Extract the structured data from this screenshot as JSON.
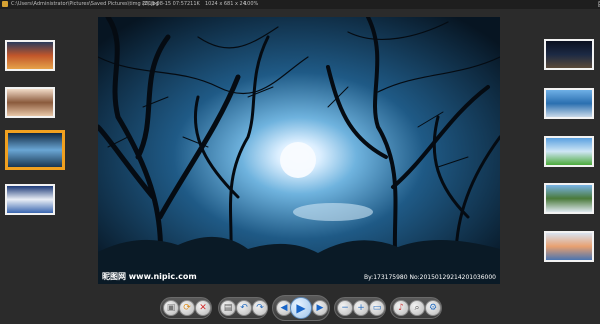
{
  "titlebar": {
    "path": "C:\\Users\\Administrator\\Pictures\\Saved Pictures\\timg (2).jpg",
    "date": "2019-08-15 07:57",
    "size": "211K",
    "dimensions": "1024 x 681 x 24",
    "zoom": "100%",
    "controls": {
      "minimize": "–",
      "maximize": "□",
      "close": "✕"
    }
  },
  "left_thumbnails": [
    {
      "name": "thumb-sunset-lake",
      "colors": [
        "#2a3b5c",
        "#c2562a",
        "#e6a24a"
      ]
    },
    {
      "name": "thumb-portrait",
      "colors": [
        "#f2dcc8",
        "#8a5a3c",
        "#e8c7a8"
      ]
    },
    {
      "name": "thumb-moon-forest",
      "colors": [
        "#0f2740",
        "#6aa6d4",
        "#1a3650"
      ],
      "selected": true
    },
    {
      "name": "thumb-night-house",
      "colors": [
        "#1d3a78",
        "#e9eef6",
        "#3a66b0"
      ]
    }
  ],
  "right_thumbnails": [
    {
      "name": "thumb-star-trails",
      "colors": [
        "#0b1020",
        "#1c2a44",
        "#5a4a3a"
      ]
    },
    {
      "name": "thumb-coast",
      "colors": [
        "#6fb0e6",
        "#2a6fb0",
        "#c9d9e8"
      ]
    },
    {
      "name": "thumb-green-field",
      "colors": [
        "#5aa0e0",
        "#cfe6f5",
        "#4caa3c"
      ]
    },
    {
      "name": "thumb-alpine-village",
      "colors": [
        "#7ab4e6",
        "#4a7a3a",
        "#dfe8ef"
      ]
    },
    {
      "name": "thumb-sunset-sea",
      "colors": [
        "#d8e2ef",
        "#e8a070",
        "#4a74b0"
      ]
    }
  ],
  "main_image": {
    "watermark_left": "昵图网 www.nipic.com",
    "watermark_right": "By:173175980 No:20150129214201036000"
  },
  "toolbar": {
    "buttons": [
      {
        "name": "open-button",
        "icon": "folder-open-icon",
        "glyph": "▣",
        "color": "#777777"
      },
      {
        "name": "rotate-settings-button",
        "icon": "rotate-icon",
        "glyph": "⟳",
        "color": "#d98a1a"
      },
      {
        "name": "delete-button",
        "icon": "close-icon",
        "glyph": "✕",
        "color": "#d02a2a"
      },
      {
        "name": "save-button",
        "icon": "save-icon",
        "glyph": "▤",
        "color": "#555555"
      },
      {
        "name": "rotate-left-button",
        "icon": "rotate-left-icon",
        "glyph": "↶",
        "color": "#2a6fc0"
      },
      {
        "name": "rotate-right-button",
        "icon": "rotate-right-icon",
        "glyph": "↷",
        "color": "#2a6fc0"
      },
      {
        "name": "previous-button",
        "icon": "arrow-left-icon",
        "glyph": "◀",
        "color": "#1a66c8"
      },
      {
        "name": "play-button",
        "icon": "play-icon",
        "glyph": "▶",
        "color": "#1a66c8"
      },
      {
        "name": "next-button",
        "icon": "arrow-right-icon",
        "glyph": "▶",
        "color": "#1a66c8"
      },
      {
        "name": "zoom-out-button",
        "icon": "zoom-out-icon",
        "glyph": "−",
        "color": "#2a6fc0"
      },
      {
        "name": "zoom-in-button",
        "icon": "zoom-in-icon",
        "glyph": "+",
        "color": "#2a6fc0"
      },
      {
        "name": "fit-window-button",
        "icon": "fit-screen-icon",
        "glyph": "▭",
        "color": "#2a6fc0"
      },
      {
        "name": "music-button",
        "icon": "music-note-icon",
        "glyph": "♪",
        "color": "#c83a3a"
      },
      {
        "name": "search-button",
        "icon": "search-icon",
        "glyph": "⌕",
        "color": "#555555"
      },
      {
        "name": "settings-button",
        "icon": "gear-icon",
        "glyph": "⚙",
        "color": "#2a6fc0"
      }
    ]
  }
}
